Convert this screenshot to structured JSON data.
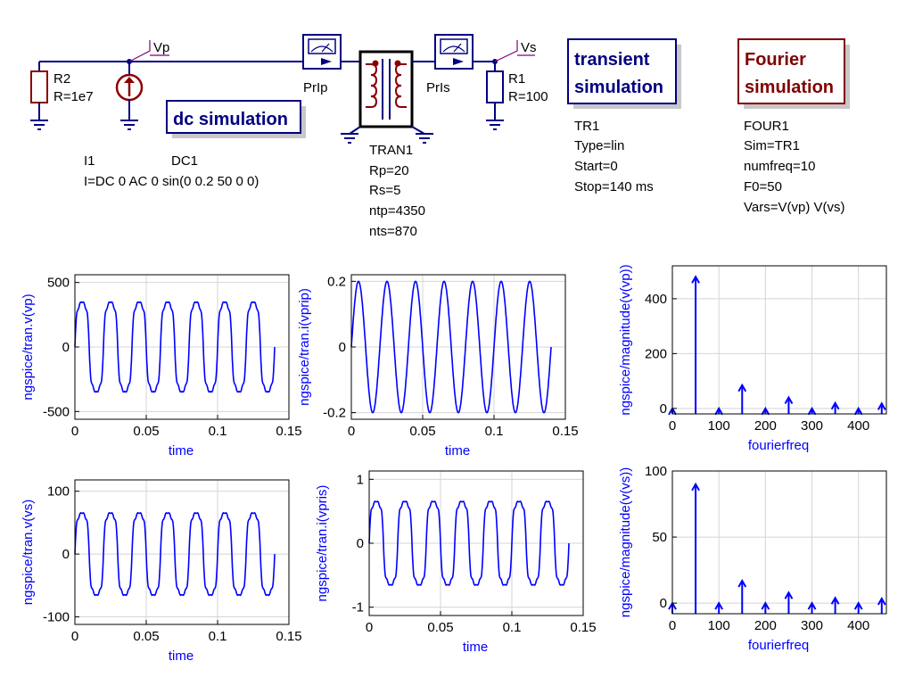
{
  "schematic": {
    "nodes": {
      "vp": "Vp",
      "vs": "Vs"
    },
    "r2": {
      "name": "R2",
      "value": "R=1e7"
    },
    "r1": {
      "name": "R1",
      "value": "R=100"
    },
    "source": {
      "name": "I1",
      "params": "I=DC 0 AC 0 sin(0 0.2 50 0 0)"
    },
    "dc_sim": {
      "title": "dc simulation",
      "name": "DC1"
    },
    "probes": {
      "primary": "PrIp",
      "secondary": "PrIs"
    },
    "transformer": {
      "name": "TRAN1",
      "params": [
        "Rp=20",
        "Rs=5",
        "ntp=4350",
        "nts=870"
      ]
    },
    "transient": {
      "title_line1": "transient",
      "title_line2": "simulation",
      "params": [
        "TR1",
        "Type=lin",
        "Start=0",
        "Stop=140 ms"
      ]
    },
    "fourier": {
      "title_line1": "Fourier",
      "title_line2": "simulation",
      "params": [
        "FOUR1",
        "Sim=TR1",
        "numfreq=10",
        "F0=50",
        "Vars=V(vp) V(vs)"
      ]
    },
    "colors": {
      "wire": "#000080",
      "title_navy": "#000080",
      "title_dark_red": "#800000",
      "source_red": "#8b0000",
      "trace": "#0000ff"
    }
  },
  "chart_data": [
    {
      "type": "line",
      "ylabel": "ngspice/tran.v(vp)",
      "xlabel": "time",
      "xlim": [
        0,
        0.15
      ],
      "ylim": [
        -560,
        560
      ],
      "xticks": [
        0,
        0.05,
        0.1,
        0.15
      ],
      "xtick_labels": [
        "0",
        "0.05",
        "0.1",
        "0.15"
      ],
      "yticks": [
        -500,
        0,
        500
      ],
      "ytick_labels": [
        "-500",
        "0",
        "500"
      ],
      "grid": true,
      "series": [
        {
          "t_end": 0.14,
          "freq": 50,
          "harmonics": [
            [
              1,
              480
            ],
            [
              3,
              85
            ],
            [
              5,
              40
            ],
            [
              7,
              20
            ]
          ],
          "amplitude": 520
        }
      ]
    },
    {
      "type": "line",
      "ylabel": "ngspice/tran.i(vprip)",
      "xlabel": "time",
      "xlim": [
        0,
        0.15
      ],
      "ylim": [
        -0.22,
        0.22
      ],
      "xticks": [
        0,
        0.05,
        0.1,
        0.15
      ],
      "xtick_labels": [
        "0",
        "0.05",
        "0.1",
        "0.15"
      ],
      "yticks": [
        -0.2,
        0,
        0.2
      ],
      "ytick_labels": [
        "-0.2",
        "0",
        "0.2"
      ],
      "grid": true,
      "series": [
        {
          "t_end": 0.14,
          "freq": 50,
          "harmonics": [
            [
              1,
              1
            ]
          ],
          "amplitude": 0.2
        }
      ]
    },
    {
      "type": "bar",
      "ylabel": "ngspice/magnitude(v(vp))",
      "xlabel": "fourierfreq",
      "xlim": [
        0,
        460
      ],
      "ylim": [
        -20,
        520
      ],
      "xticks": [
        0,
        100,
        200,
        300,
        400
      ],
      "xtick_labels": [
        "0",
        "100",
        "200",
        "300",
        "400"
      ],
      "yticks": [
        0,
        200,
        400
      ],
      "ytick_labels": [
        "0",
        "200",
        "400"
      ],
      "grid": true,
      "x": [
        0,
        50,
        100,
        150,
        200,
        250,
        300,
        350,
        400,
        450
      ],
      "values": [
        0,
        480,
        0,
        85,
        0,
        40,
        0,
        20,
        0,
        18
      ]
    },
    {
      "type": "line",
      "ylabel": "ngspice/tran.v(vs)",
      "xlabel": "time",
      "xlim": [
        0,
        0.15
      ],
      "ylim": [
        -112,
        118
      ],
      "xticks": [
        0,
        0.05,
        0.1,
        0.15
      ],
      "xtick_labels": [
        "0",
        "0.05",
        "0.1",
        "0.15"
      ],
      "yticks": [
        -100,
        0,
        100
      ],
      "ytick_labels": [
        "-100",
        "0",
        "100"
      ],
      "grid": true,
      "series": [
        {
          "t_end": 0.14,
          "freq": 50,
          "harmonics": [
            [
              1,
              90
            ],
            [
              3,
              17
            ],
            [
              5,
              8
            ],
            [
              7,
              4
            ]
          ],
          "amplitude": 100
        }
      ]
    },
    {
      "type": "line",
      "ylabel": "ngspice/tran.i(vpris)",
      "xlabel": "time",
      "xlim": [
        0,
        0.15
      ],
      "ylim": [
        -1.13,
        1.13
      ],
      "xticks": [
        0,
        0.05,
        0.1,
        0.15
      ],
      "xtick_labels": [
        "0",
        "0.05",
        "0.1",
        "0.15"
      ],
      "yticks": [
        -1,
        0,
        1
      ],
      "ytick_labels": [
        "-1",
        "0",
        "1"
      ],
      "grid": true,
      "series": [
        {
          "t_end": 0.14,
          "freq": 50,
          "harmonics": [
            [
              1,
              90
            ],
            [
              3,
              17
            ],
            [
              5,
              8
            ],
            [
              7,
              4
            ]
          ],
          "amplitude": 1
        }
      ]
    },
    {
      "type": "bar",
      "ylabel": "ngspice/magnitude(v(vs))",
      "xlabel": "fourierfreq",
      "xlim": [
        0,
        460
      ],
      "ylim": [
        -8,
        100
      ],
      "xticks": [
        0,
        100,
        200,
        300,
        400
      ],
      "xtick_labels": [
        "0",
        "100",
        "200",
        "300",
        "400"
      ],
      "yticks": [
        0,
        50,
        100
      ],
      "ytick_labels": [
        "0",
        "50",
        "100"
      ],
      "grid": true,
      "x": [
        0,
        50,
        100,
        150,
        200,
        250,
        300,
        350,
        400,
        450
      ],
      "values": [
        0,
        90,
        0,
        17,
        0,
        8,
        0,
        4,
        0,
        3.5
      ]
    }
  ]
}
